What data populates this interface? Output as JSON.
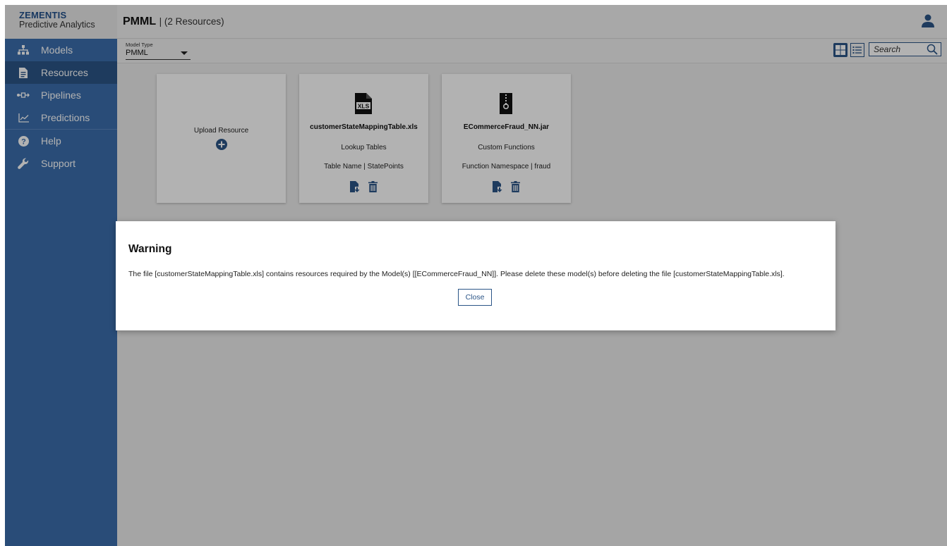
{
  "brand": {
    "line1": "ZEMENTIS",
    "line2": "Predictive Analytics"
  },
  "header": {
    "title": "PMML",
    "subtitle": "| (2 Resources)",
    "user_icon": "user-icon"
  },
  "sidebar": {
    "items": [
      {
        "label": "Models",
        "icon": "sitemap-icon",
        "active": false
      },
      {
        "label": "Resources",
        "icon": "file-icon",
        "active": true
      },
      {
        "label": "Pipelines",
        "icon": "pipeline-icon",
        "active": false
      },
      {
        "label": "Predictions",
        "icon": "line-chart-icon",
        "active": false
      },
      {
        "label": "Help",
        "icon": "help-icon",
        "active": false
      },
      {
        "label": "Support",
        "icon": "wrench-icon",
        "active": false
      }
    ]
  },
  "toolbar": {
    "model_type_label": "Model Type",
    "model_type_value": "PMML",
    "search_placeholder": "Search"
  },
  "cards": {
    "upload": {
      "label": "Upload Resource"
    },
    "items": [
      {
        "file_name": "customerStateMappingTable.xls",
        "type": "Lookup Tables",
        "detail": "Table Name | StatePoints",
        "icon": "xls-file-icon"
      },
      {
        "file_name": "ECommerceFraud_NN.jar",
        "type": "Custom Functions",
        "detail": "Function Namespace | fraud",
        "icon": "zip-file-icon"
      }
    ]
  },
  "dialog": {
    "title": "Warning",
    "message": "The file [customerStateMappingTable.xls] contains resources required by the Model(s) [[ECommerceFraud_NN]]. Please delete these model(s) before deleting the file [customerStateMappingTable.xls].",
    "close_label": "Close"
  },
  "colors": {
    "brand_blue": "#23518c",
    "sidebar": "#3b6ead",
    "sidebar_active": "#2b5587"
  }
}
